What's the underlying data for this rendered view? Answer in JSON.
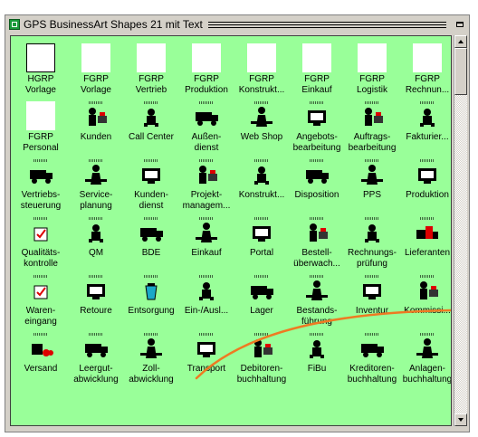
{
  "window": {
    "title": "GPS BusinessArt Shapes 21 mit Text"
  },
  "shapes": [
    {
      "l1": "HGRP",
      "l2": "Vorlage",
      "icon": "blank-template-icon"
    },
    {
      "l1": "FGRP",
      "l2": "Vorlage",
      "icon": "blank-template-icon"
    },
    {
      "l1": "FGRP",
      "l2": "Vertrieb",
      "icon": "blank-template-icon"
    },
    {
      "l1": "FGRP",
      "l2": "Produktion",
      "icon": "blank-template-icon"
    },
    {
      "l1": "FGRP",
      "l2": "Konstrukt...",
      "icon": "blank-template-icon"
    },
    {
      "l1": "FGRP",
      "l2": "Einkauf",
      "icon": "blank-template-icon"
    },
    {
      "l1": "FGRP",
      "l2": "Logistik",
      "icon": "blank-template-icon"
    },
    {
      "l1": "FGRP",
      "l2": "Rechnun...",
      "icon": "blank-template-icon"
    },
    {
      "l1": "FGRP",
      "l2": "Personal",
      "icon": "blank-template-icon"
    },
    {
      "l1": "Kunden",
      "l2": "",
      "icon": "customers-icon"
    },
    {
      "l1": "Call Center",
      "l2": "",
      "icon": "call-center-icon"
    },
    {
      "l1": "Außen-",
      "l2": "dienst",
      "icon": "field-service-icon"
    },
    {
      "l1": "Web Shop",
      "l2": "",
      "icon": "web-shop-icon"
    },
    {
      "l1": "Angebots-",
      "l2": "bearbeitung",
      "icon": "quote-processing-icon"
    },
    {
      "l1": "Auftrags-",
      "l2": "bearbeitung",
      "icon": "order-processing-icon"
    },
    {
      "l1": "Fakturier...",
      "l2": "",
      "icon": "invoicing-icon"
    },
    {
      "l1": "Vertriebs-",
      "l2": "steuerung",
      "icon": "sales-control-icon"
    },
    {
      "l1": "Service-",
      "l2": "planung",
      "icon": "service-planning-icon"
    },
    {
      "l1": "Kunden-",
      "l2": "dienst",
      "icon": "customer-service-icon"
    },
    {
      "l1": "Projekt-",
      "l2": "managem...",
      "icon": "project-management-icon"
    },
    {
      "l1": "Konstrukt...",
      "l2": "",
      "icon": "construction-icon"
    },
    {
      "l1": "Disposition",
      "l2": "",
      "icon": "disposition-icon"
    },
    {
      "l1": "PPS",
      "l2": "",
      "icon": "pps-icon"
    },
    {
      "l1": "Produktion",
      "l2": "",
      "icon": "production-icon"
    },
    {
      "l1": "Qualitäts-",
      "l2": "kontrolle",
      "icon": "quality-control-icon"
    },
    {
      "l1": "QM",
      "l2": "",
      "icon": "qm-icon"
    },
    {
      "l1": "BDE",
      "l2": "",
      "icon": "bde-icon"
    },
    {
      "l1": "Einkauf",
      "l2": "",
      "icon": "purchasing-icon"
    },
    {
      "l1": "Portal",
      "l2": "",
      "icon": "portal-icon"
    },
    {
      "l1": "Bestell-",
      "l2": "überwach...",
      "icon": "order-monitoring-icon"
    },
    {
      "l1": "Rechnungs-",
      "l2": "prüfung",
      "icon": "invoice-check-icon"
    },
    {
      "l1": "Lieferanten",
      "l2": "",
      "icon": "suppliers-icon"
    },
    {
      "l1": "Waren-",
      "l2": "eingang",
      "icon": "goods-receipt-icon"
    },
    {
      "l1": "Retoure",
      "l2": "",
      "icon": "return-truck-icon"
    },
    {
      "l1": "Entsorgung",
      "l2": "",
      "icon": "disposal-icon"
    },
    {
      "l1": "Ein-/Ausl...",
      "l2": "",
      "icon": "in-out-storage-icon"
    },
    {
      "l1": "Lager",
      "l2": "",
      "icon": "warehouse-icon"
    },
    {
      "l1": "Bestands-",
      "l2": "führung",
      "icon": "inventory-management-icon"
    },
    {
      "l1": "Inventur",
      "l2": "",
      "icon": "stocktaking-icon"
    },
    {
      "l1": "Kommissi...",
      "l2": "",
      "icon": "picking-icon"
    },
    {
      "l1": "Versand",
      "l2": "",
      "icon": "shipping-icon"
    },
    {
      "l1": "Leergut-",
      "l2": "abwicklung",
      "icon": "empties-icon"
    },
    {
      "l1": "Zoll-",
      "l2": "abwicklung",
      "icon": "customs-icon"
    },
    {
      "l1": "Transport",
      "l2": "",
      "icon": "transport-truck-icon"
    },
    {
      "l1": "Debitoren-",
      "l2": "buchhaltung",
      "icon": "accounts-receivable-icon"
    },
    {
      "l1": "FiBu",
      "l2": "",
      "icon": "fibu-icon"
    },
    {
      "l1": "Kreditoren-",
      "l2": "buchhaltung",
      "icon": "accounts-payable-icon"
    },
    {
      "l1": "Anlagen-",
      "l2": "buchhaltung",
      "icon": "asset-accounting-icon"
    }
  ],
  "colors": {
    "background": "#99ff99",
    "accent_curve": "#ee7a22",
    "red": "#dd0000"
  }
}
